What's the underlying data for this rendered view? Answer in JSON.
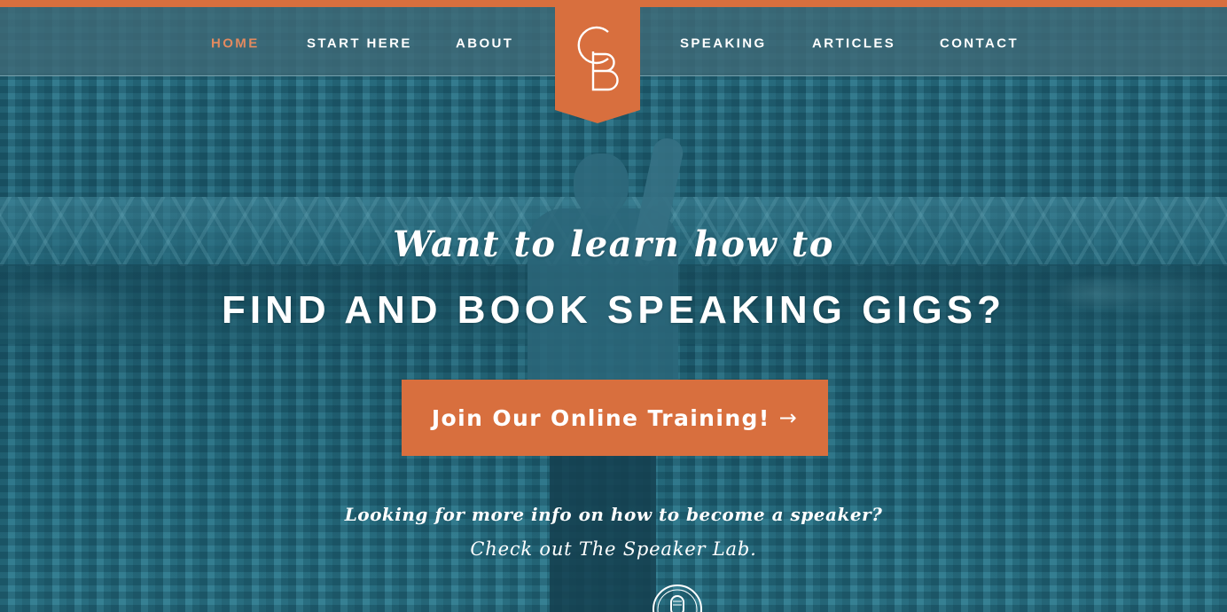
{
  "colors": {
    "accent": "#d86f3e",
    "nav_active": "#e38a5f",
    "hero_tint": "#2a6f82",
    "text": "#ffffff"
  },
  "nav": {
    "left": [
      {
        "label": "HOME",
        "active": true
      },
      {
        "label": "START HERE",
        "active": false
      },
      {
        "label": "ABOUT",
        "active": false
      }
    ],
    "right": [
      {
        "label": "SPEAKING",
        "active": false
      },
      {
        "label": "ARTICLES",
        "active": false
      },
      {
        "label": "CONTACT",
        "active": false
      }
    ]
  },
  "logo": {
    "letters": "CB",
    "icon": "cb-monogram-icon"
  },
  "hero": {
    "kicker": "Want to learn how to",
    "title": "FIND AND BOOK SPEAKING GIGS?",
    "cta_label": "Join Our Online Training!",
    "cta_arrow": "→",
    "info": "Looking for more info on how to become a speaker?",
    "link": "Check out The Speaker Lab.",
    "badge_icon": "microphone-icon"
  }
}
